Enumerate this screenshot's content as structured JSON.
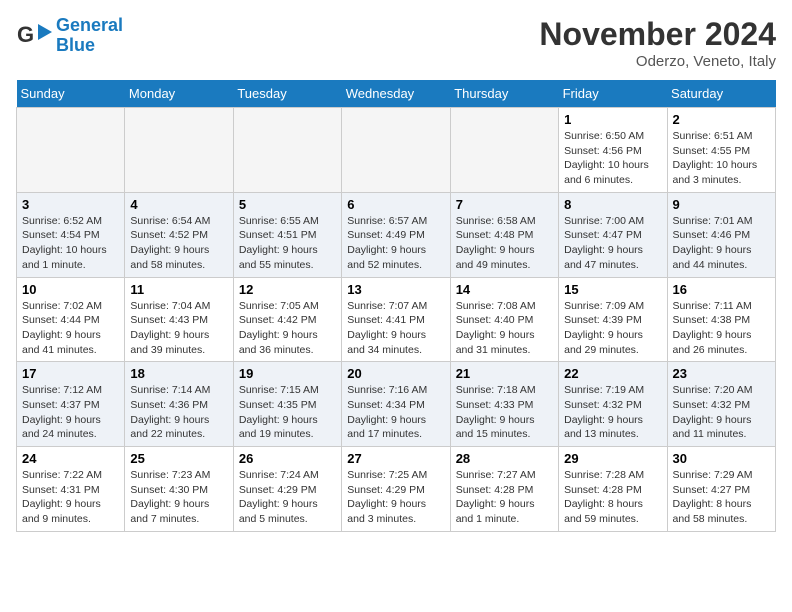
{
  "header": {
    "logo_line1": "General",
    "logo_line2": "Blue",
    "title": "November 2024",
    "location": "Oderzo, Veneto, Italy"
  },
  "weekdays": [
    "Sunday",
    "Monday",
    "Tuesday",
    "Wednesday",
    "Thursday",
    "Friday",
    "Saturday"
  ],
  "weeks": [
    [
      {
        "day": "",
        "info": ""
      },
      {
        "day": "",
        "info": ""
      },
      {
        "day": "",
        "info": ""
      },
      {
        "day": "",
        "info": ""
      },
      {
        "day": "",
        "info": ""
      },
      {
        "day": "1",
        "info": "Sunrise: 6:50 AM\nSunset: 4:56 PM\nDaylight: 10 hours and 6 minutes."
      },
      {
        "day": "2",
        "info": "Sunrise: 6:51 AM\nSunset: 4:55 PM\nDaylight: 10 hours and 3 minutes."
      }
    ],
    [
      {
        "day": "3",
        "info": "Sunrise: 6:52 AM\nSunset: 4:54 PM\nDaylight: 10 hours and 1 minute."
      },
      {
        "day": "4",
        "info": "Sunrise: 6:54 AM\nSunset: 4:52 PM\nDaylight: 9 hours and 58 minutes."
      },
      {
        "day": "5",
        "info": "Sunrise: 6:55 AM\nSunset: 4:51 PM\nDaylight: 9 hours and 55 minutes."
      },
      {
        "day": "6",
        "info": "Sunrise: 6:57 AM\nSunset: 4:49 PM\nDaylight: 9 hours and 52 minutes."
      },
      {
        "day": "7",
        "info": "Sunrise: 6:58 AM\nSunset: 4:48 PM\nDaylight: 9 hours and 49 minutes."
      },
      {
        "day": "8",
        "info": "Sunrise: 7:00 AM\nSunset: 4:47 PM\nDaylight: 9 hours and 47 minutes."
      },
      {
        "day": "9",
        "info": "Sunrise: 7:01 AM\nSunset: 4:46 PM\nDaylight: 9 hours and 44 minutes."
      }
    ],
    [
      {
        "day": "10",
        "info": "Sunrise: 7:02 AM\nSunset: 4:44 PM\nDaylight: 9 hours and 41 minutes."
      },
      {
        "day": "11",
        "info": "Sunrise: 7:04 AM\nSunset: 4:43 PM\nDaylight: 9 hours and 39 minutes."
      },
      {
        "day": "12",
        "info": "Sunrise: 7:05 AM\nSunset: 4:42 PM\nDaylight: 9 hours and 36 minutes."
      },
      {
        "day": "13",
        "info": "Sunrise: 7:07 AM\nSunset: 4:41 PM\nDaylight: 9 hours and 34 minutes."
      },
      {
        "day": "14",
        "info": "Sunrise: 7:08 AM\nSunset: 4:40 PM\nDaylight: 9 hours and 31 minutes."
      },
      {
        "day": "15",
        "info": "Sunrise: 7:09 AM\nSunset: 4:39 PM\nDaylight: 9 hours and 29 minutes."
      },
      {
        "day": "16",
        "info": "Sunrise: 7:11 AM\nSunset: 4:38 PM\nDaylight: 9 hours and 26 minutes."
      }
    ],
    [
      {
        "day": "17",
        "info": "Sunrise: 7:12 AM\nSunset: 4:37 PM\nDaylight: 9 hours and 24 minutes."
      },
      {
        "day": "18",
        "info": "Sunrise: 7:14 AM\nSunset: 4:36 PM\nDaylight: 9 hours and 22 minutes."
      },
      {
        "day": "19",
        "info": "Sunrise: 7:15 AM\nSunset: 4:35 PM\nDaylight: 9 hours and 19 minutes."
      },
      {
        "day": "20",
        "info": "Sunrise: 7:16 AM\nSunset: 4:34 PM\nDaylight: 9 hours and 17 minutes."
      },
      {
        "day": "21",
        "info": "Sunrise: 7:18 AM\nSunset: 4:33 PM\nDaylight: 9 hours and 15 minutes."
      },
      {
        "day": "22",
        "info": "Sunrise: 7:19 AM\nSunset: 4:32 PM\nDaylight: 9 hours and 13 minutes."
      },
      {
        "day": "23",
        "info": "Sunrise: 7:20 AM\nSunset: 4:32 PM\nDaylight: 9 hours and 11 minutes."
      }
    ],
    [
      {
        "day": "24",
        "info": "Sunrise: 7:22 AM\nSunset: 4:31 PM\nDaylight: 9 hours and 9 minutes."
      },
      {
        "day": "25",
        "info": "Sunrise: 7:23 AM\nSunset: 4:30 PM\nDaylight: 9 hours and 7 minutes."
      },
      {
        "day": "26",
        "info": "Sunrise: 7:24 AM\nSunset: 4:29 PM\nDaylight: 9 hours and 5 minutes."
      },
      {
        "day": "27",
        "info": "Sunrise: 7:25 AM\nSunset: 4:29 PM\nDaylight: 9 hours and 3 minutes."
      },
      {
        "day": "28",
        "info": "Sunrise: 7:27 AM\nSunset: 4:28 PM\nDaylight: 9 hours and 1 minute."
      },
      {
        "day": "29",
        "info": "Sunrise: 7:28 AM\nSunset: 4:28 PM\nDaylight: 8 hours and 59 minutes."
      },
      {
        "day": "30",
        "info": "Sunrise: 7:29 AM\nSunset: 4:27 PM\nDaylight: 8 hours and 58 minutes."
      }
    ]
  ]
}
